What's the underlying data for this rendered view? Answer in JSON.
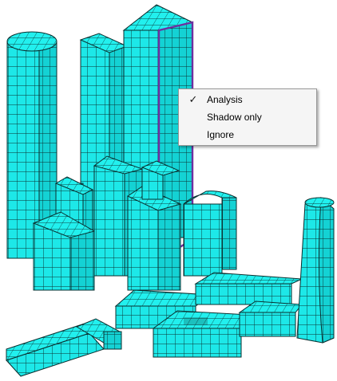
{
  "colors": {
    "mesh_fill": "#1de8e8",
    "mesh_side": "#12c9cc",
    "mesh_line": "#0a2f2f",
    "selection_outline": "#6f2fa0",
    "background": "#ffffff"
  },
  "context_menu": {
    "items": [
      {
        "label": "Analysis",
        "checked": true,
        "check_icon": "checkmark-icon"
      },
      {
        "label": "Shadow only",
        "checked": false
      },
      {
        "label": "Ignore",
        "checked": false
      }
    ],
    "check_glyph": "✓"
  }
}
